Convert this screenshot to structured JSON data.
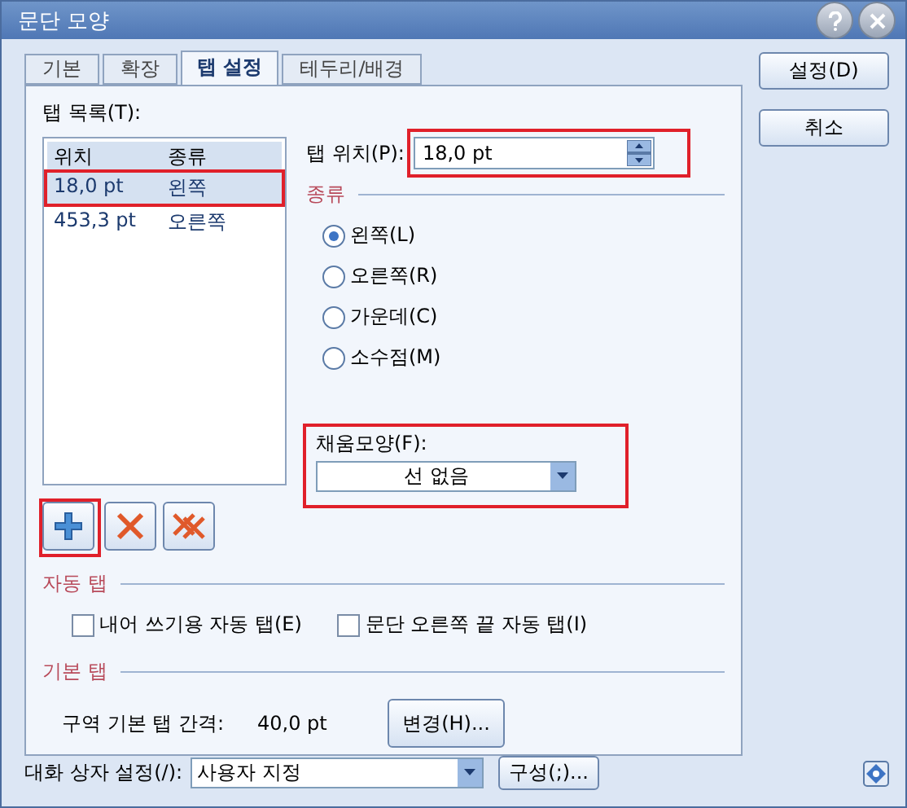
{
  "window": {
    "title": "문단 모양"
  },
  "tabs": [
    {
      "label": "기본",
      "selected": false
    },
    {
      "label": "확장",
      "selected": false
    },
    {
      "label": "탭 설정",
      "selected": true
    },
    {
      "label": "테두리/배경",
      "selected": false
    }
  ],
  "tab_list": {
    "label": "탭 목록(T):",
    "columns": [
      "위치",
      "종류"
    ],
    "rows": [
      {
        "cells": [
          "18,0 pt",
          "왼쪽"
        ],
        "selected": true,
        "highlighted": true
      },
      {
        "cells": [
          "453,3 pt",
          "오른쪽"
        ],
        "selected": false,
        "highlighted": false
      }
    ]
  },
  "tab_position": {
    "label": "탭 위치(P):",
    "value": "18,0 pt",
    "highlighted": true
  },
  "kind_section": {
    "title": "종류",
    "options": [
      {
        "label": "왼쪽(L)",
        "selected": true
      },
      {
        "label": "오른쪽(R)",
        "selected": false
      },
      {
        "label": "가운데(C)",
        "selected": false
      },
      {
        "label": "소수점(M)",
        "selected": false
      }
    ]
  },
  "fill": {
    "label": "채움모양(F):",
    "value": "선 없음",
    "highlighted": true
  },
  "list_buttons": [
    {
      "kind": "add",
      "highlighted": true
    },
    {
      "kind": "delete",
      "highlighted": false
    },
    {
      "kind": "delete_all",
      "highlighted": false
    }
  ],
  "auto_tab": {
    "title": "자동 탭",
    "checkboxes": [
      {
        "label": "내어 쓰기용 자동 탭(E)",
        "checked": false
      },
      {
        "label": "문단 오른쪽 끝 자동 탭(I)",
        "checked": false
      }
    ]
  },
  "default_tab": {
    "title": "기본 탭",
    "label": "구역 기본 탭 간격:",
    "value": "40,0 pt",
    "button": "변경(H)..."
  },
  "side_buttons": [
    "설정(D)",
    "취소"
  ],
  "footer": {
    "label": "대화 상자 설정(/):",
    "value": "사용자 지정",
    "button": "구성(;)..."
  }
}
